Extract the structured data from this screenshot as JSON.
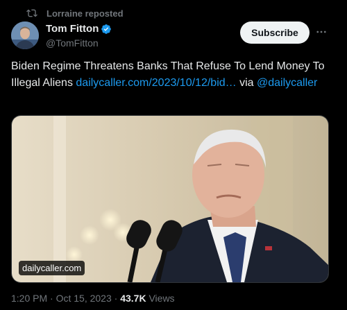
{
  "repost": {
    "text": "Lorraine reposted",
    "icon": "repost-icon"
  },
  "author": {
    "name": "Tom Fitton",
    "handle": "@TomFitton",
    "verified": true,
    "verified_color": "#1d9bf0"
  },
  "subscribe_label": "Subscribe",
  "more_icon": "more-dots-icon",
  "tweet": {
    "text_before": "Biden Regime Threatens Banks That Refuse To Lend Money To Illegal Aliens ",
    "link_text": "dailycaller.com/2023/10/12/bid…",
    "text_middle": " via ",
    "mention": "@dailycaller"
  },
  "media": {
    "domain": "dailycaller.com"
  },
  "meta": {
    "time": "1:20 PM",
    "separator1": " · ",
    "date": "Oct 15, 2023",
    "separator2": " · ",
    "views": "43.7K",
    "views_label": " Views"
  },
  "colors": {
    "background": "#000000",
    "text": "#e7e9ea",
    "muted": "#71767b",
    "link": "#1d9bf0"
  }
}
